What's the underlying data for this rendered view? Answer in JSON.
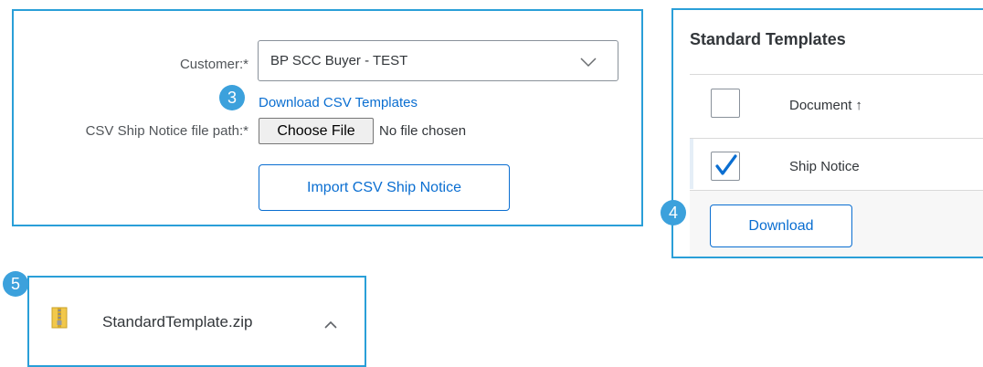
{
  "import_form": {
    "customer_label": "Customer:*",
    "customer_value": "BP SCC Buyer - TEST",
    "download_link": "Download CSV Templates",
    "file_path_label": "CSV Ship Notice file path:*",
    "choose_file_label": "Choose File",
    "no_file_text": "No file chosen",
    "import_button": "Import CSV Ship Notice"
  },
  "templates_panel": {
    "title": "Standard Templates",
    "column_header": "Document",
    "sort_indicator": "↑",
    "rows": [
      {
        "document": "Ship Notice",
        "checked": true
      }
    ],
    "download_button": "Download"
  },
  "download_bar": {
    "file_name": "StandardTemplate.zip",
    "file_icon": "zip-folder-icon",
    "expand_icon": "chevron-up-icon"
  },
  "step_badges": {
    "link": "3",
    "download": "4",
    "file": "5"
  },
  "colors": {
    "panel_border": "#2a9fd8",
    "accent_blue": "#0a6ed1",
    "badge_blue": "#3ca1dc"
  }
}
